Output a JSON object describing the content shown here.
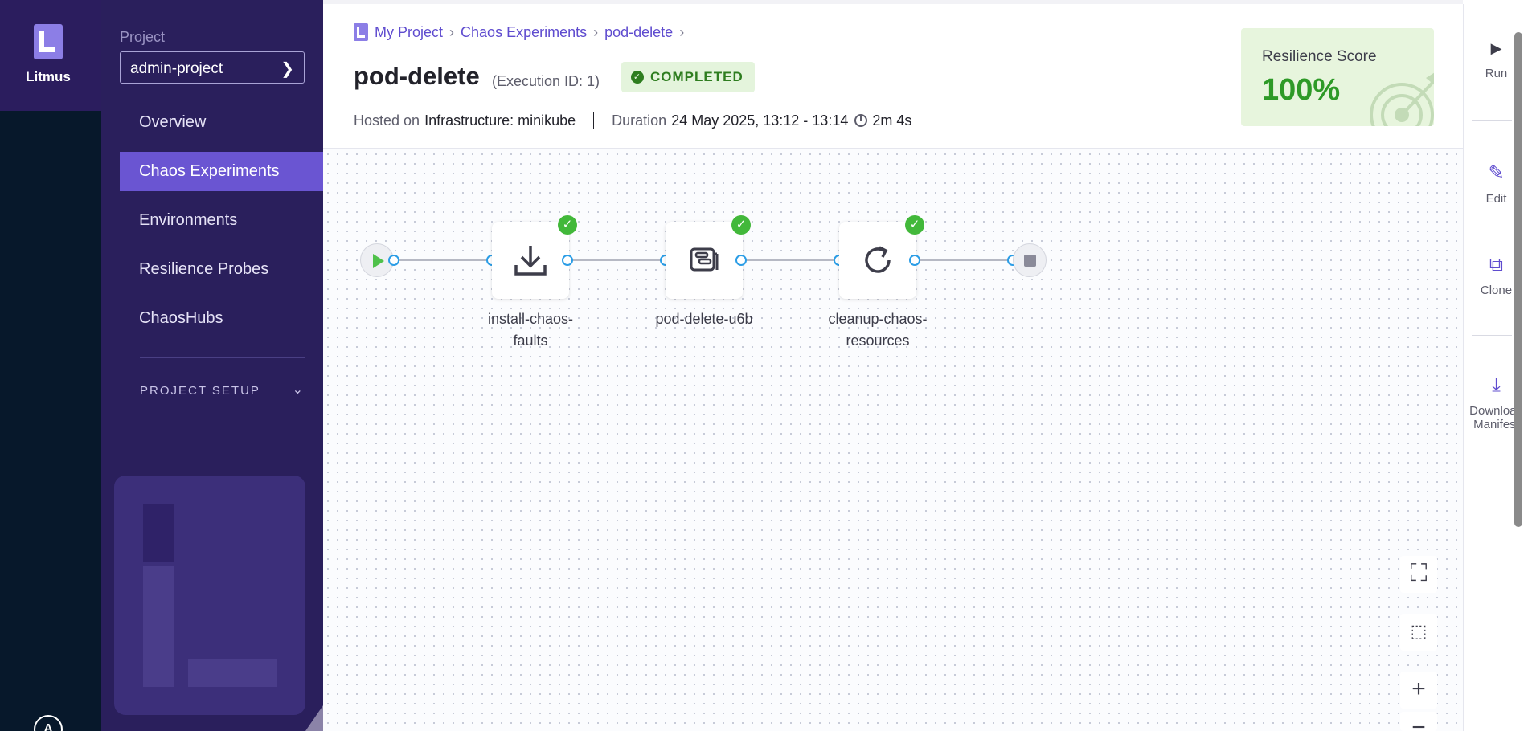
{
  "app": {
    "name": "Litmus",
    "avatar_initial": "A"
  },
  "sidebar": {
    "project_label": "Project",
    "project_value": "admin-project",
    "items": [
      {
        "label": "Overview",
        "active": false
      },
      {
        "label": "Chaos Experiments",
        "active": true
      },
      {
        "label": "Environments",
        "active": false
      },
      {
        "label": "Resilience Probes",
        "active": false
      },
      {
        "label": "ChaosHubs",
        "active": false
      }
    ],
    "setup_label": "PROJECT SETUP"
  },
  "header": {
    "breadcrumbs": [
      "My Project",
      "Chaos Experiments",
      "pod-delete"
    ],
    "title": "pod-delete",
    "execution_id": "(Execution ID: 1)",
    "status": "COMPLETED",
    "hosted_label": "Hosted on",
    "hosted_value": "Infrastructure: minikube",
    "duration_label": "Duration",
    "duration_range": "24 May 2025, 13:12 - 13:14",
    "duration_value": "2m 4s",
    "resilience_label": "Resilience Score",
    "resilience_value": "100%"
  },
  "workflow": {
    "nodes": [
      {
        "label": "install-chaos-\nfaults",
        "icon": "download-icon",
        "status": "succeeded"
      },
      {
        "label": "pod-delete-u6b",
        "icon": "fault-icon",
        "status": "succeeded"
      },
      {
        "label": "cleanup-chaos-\nresources",
        "icon": "refresh-icon",
        "status": "succeeded"
      }
    ]
  },
  "toolbar": {
    "run": "Run",
    "edit": "Edit",
    "clone": "Clone",
    "download_manifest": "Download Manifest"
  },
  "colors": {
    "accent": "#6a55d2",
    "sidebar": "#2a1f5c",
    "rail": "#07182b",
    "success": "#42b83a",
    "port": "#2b9de6"
  }
}
